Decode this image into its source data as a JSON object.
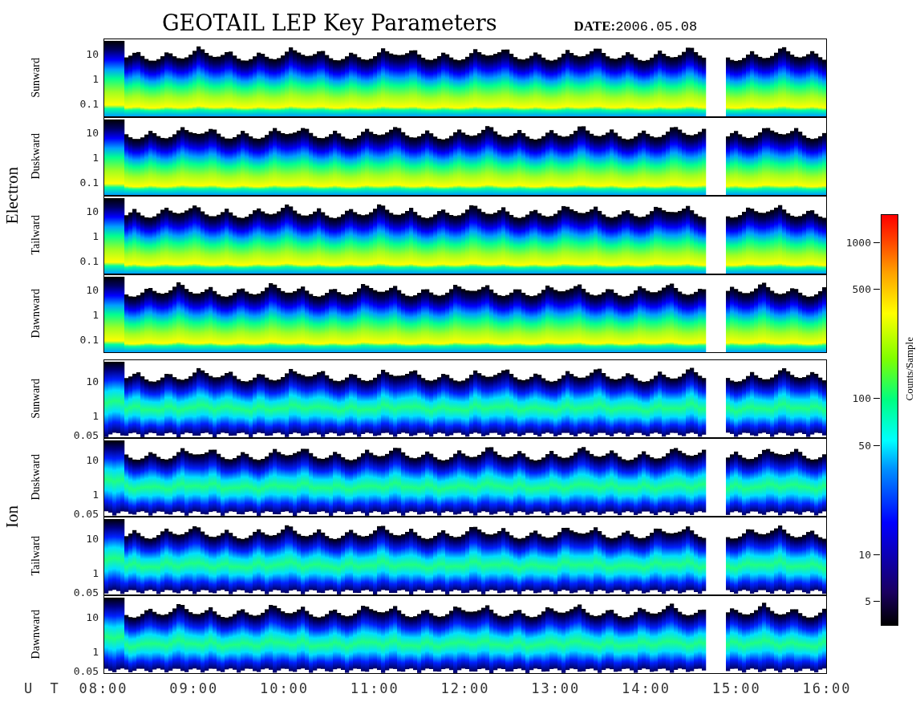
{
  "title": "GEOTAIL LEP Key Parameters",
  "date": {
    "label": "DATE:",
    "value": "2006.05.08"
  },
  "groups": [
    {
      "kind": "electron",
      "label": "Electron",
      "panels": [
        {
          "direction": "Sunward",
          "yticks": [
            "10",
            "1",
            "0.1"
          ]
        },
        {
          "direction": "Duskward",
          "yticks": [
            "10",
            "1",
            "0.1"
          ]
        },
        {
          "direction": "Tailward",
          "yticks": [
            "10",
            "1",
            "0.1"
          ]
        },
        {
          "direction": "Dawnward",
          "yticks": [
            "10",
            "1",
            "0.1"
          ]
        }
      ]
    },
    {
      "kind": "ion",
      "label": "Ion",
      "panels": [
        {
          "direction": "Sunward",
          "yticks": [
            "10",
            "1",
            "0.05"
          ]
        },
        {
          "direction": "Duskward",
          "yticks": [
            "10",
            "1",
            "0.05"
          ]
        },
        {
          "direction": "Tailward",
          "yticks": [
            "10",
            "1",
            "0.05"
          ]
        },
        {
          "direction": "Dawnward",
          "yticks": [
            "10",
            "1",
            "0.05"
          ]
        }
      ]
    }
  ],
  "x_axis": {
    "label": "U T",
    "ticks": [
      "08:00",
      "09:00",
      "10:00",
      "11:00",
      "12:00",
      "13:00",
      "14:00",
      "15:00",
      "16:00"
    ]
  },
  "colorbar": {
    "title": "Counts/Sample",
    "ticks": [
      "1000",
      "500",
      "100",
      "50",
      "10",
      "5"
    ]
  }
}
